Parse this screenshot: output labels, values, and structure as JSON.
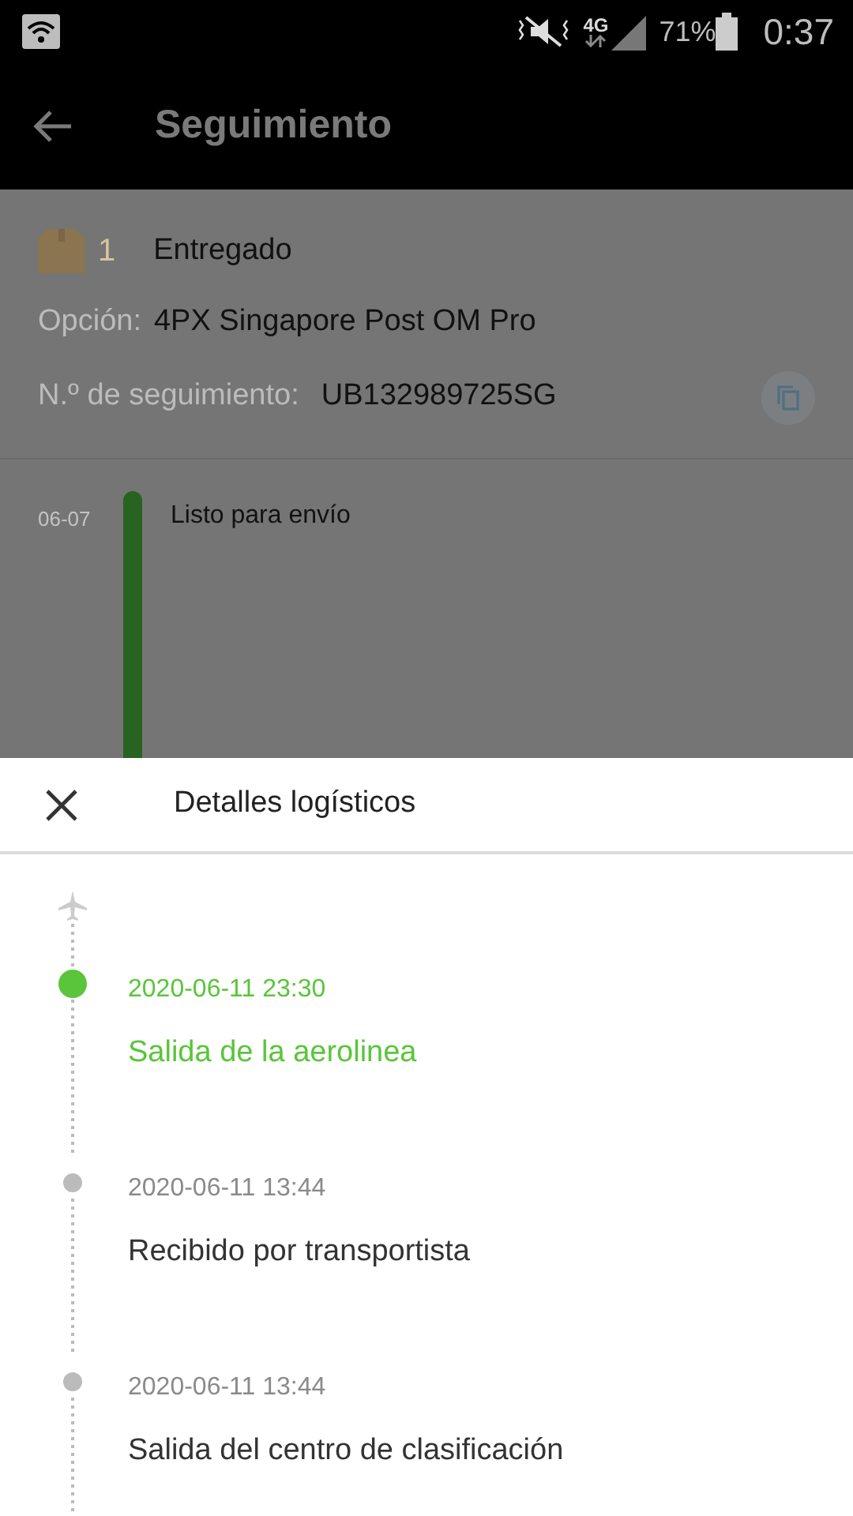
{
  "status_bar": {
    "network": "4G",
    "battery": "71%",
    "time": "0:37"
  },
  "app_bar": {
    "title": "Seguimiento"
  },
  "package": {
    "count": "1",
    "status": "Entregado",
    "option_label": "Opción:",
    "option_value": "4PX Singapore Post OM Pro",
    "tracking_label": "N.º de seguimiento:",
    "tracking_value": "UB132989725SG"
  },
  "summary_timeline": [
    {
      "date": "06-07",
      "text": "Listo para envío"
    }
  ],
  "sheet": {
    "title": "Detalles logísticos",
    "events": [
      {
        "time": "2020-06-11 23:30",
        "text": "Salida de la aerolinea",
        "current": true
      },
      {
        "time": "2020-06-11 13:44",
        "text": "Recibido por transportista",
        "current": false
      },
      {
        "time": "2020-06-11 13:44",
        "text": "Salida del centro de clasificación",
        "current": false
      }
    ]
  }
}
